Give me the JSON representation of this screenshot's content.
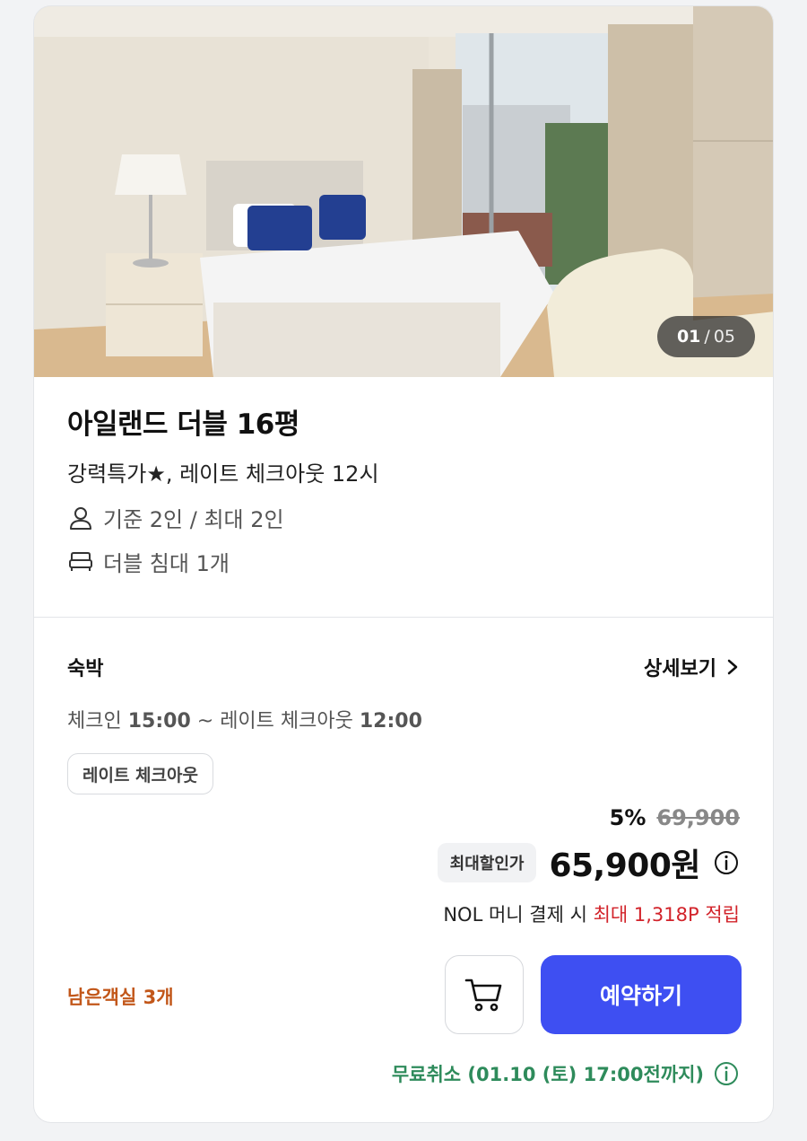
{
  "gallery": {
    "current": "01",
    "separator": " / ",
    "total": "05"
  },
  "room": {
    "name": "아일랜드 더블 16평",
    "subtitle": "강력특가★, 레이트 체크아웃 12시",
    "occupancy": "기준 2인 / 최대 2인",
    "bed": "더블 침대 1개"
  },
  "stay": {
    "label": "숙박",
    "detail_link": "상세보기",
    "checkin_label": "체크인",
    "checkin_time": "15:00",
    "checkout_label": " ~ 레이트 체크아웃 ",
    "checkout_time": "12:00",
    "tag": "레이트 체크아웃"
  },
  "price": {
    "discount_rate": "5%",
    "original": "69,900",
    "max_discount_label": "최대할인가",
    "final": "65,900원",
    "points_prefix": "NOL 머니 결제 시 ",
    "points_highlight": "최대 1,318P 적립"
  },
  "availability": {
    "remaining": "남은객실 3개"
  },
  "actions": {
    "reserve_label": "예약하기"
  },
  "cancellation": {
    "text": "무료취소 (01.10 (토) 17:00전까지)"
  },
  "colors": {
    "primary": "#3e4ff2",
    "remaining": "#c2571a",
    "points": "#d2232a",
    "cancel": "#2e8b5b"
  },
  "icons": [
    "person-icon",
    "bed-icon",
    "chevron-right-icon",
    "info-icon",
    "cart-icon"
  ]
}
